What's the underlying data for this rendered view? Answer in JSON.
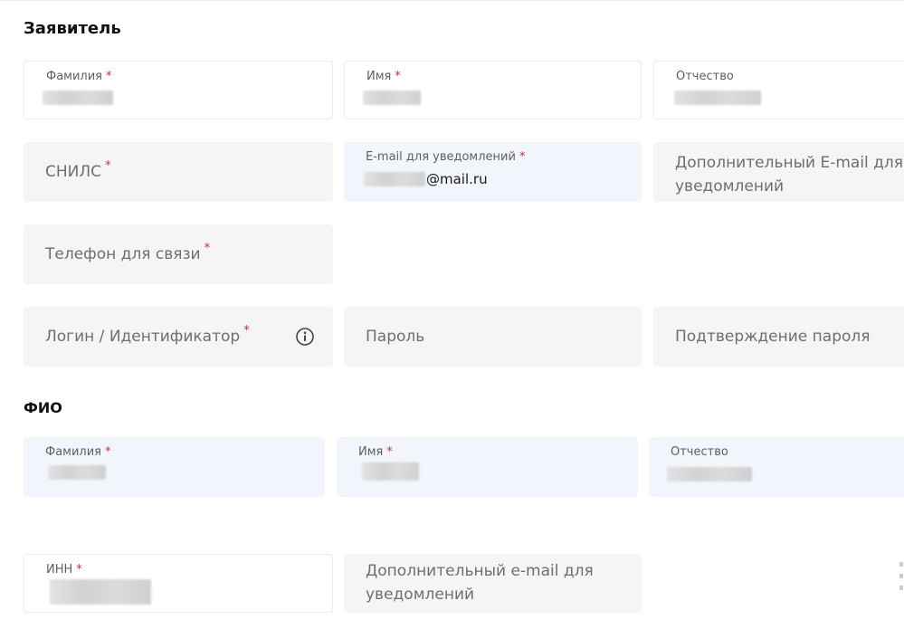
{
  "sections": {
    "applicant_title": "Заявитель",
    "fio_title": "ФИО"
  },
  "applicant": {
    "lastname_label": "Фамилия",
    "firstname_label": "Имя",
    "middlename_label": "Отчество",
    "snils_label": "СНИЛС",
    "email_label": "E-mail для уведомлений",
    "email_domain": "@mail.ru",
    "extra_email_label": "Дополнительный E-mail для уведомлений",
    "phone_label": "Телефон для связи",
    "login_label": "Логин / Идентификатор",
    "password_label": "Пароль",
    "password_confirm_label": "Подтверждение пароля"
  },
  "fio": {
    "lastname_label": "Фамилия",
    "firstname_label": "Имя",
    "middlename_label": "Отчество"
  },
  "company": {
    "inn_label": "ИНН",
    "extra_email_label": "Дополнительный e-mail для уведомлений"
  },
  "required_mark": "*",
  "icons": {
    "login_info": "info-icon"
  },
  "colors": {
    "required": "#d32f2f",
    "field_bg": "#f5f5f5",
    "field_active_bg": "#f2f6fc"
  }
}
